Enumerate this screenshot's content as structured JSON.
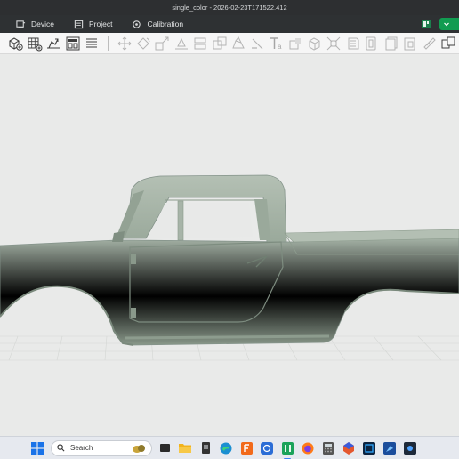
{
  "window": {
    "title": "single_color - 2026-02-23T171522.412"
  },
  "menu": [
    {
      "label": "Device",
      "icon": "device-icon"
    },
    {
      "label": "Project",
      "icon": "project-icon"
    },
    {
      "label": "Calibration",
      "icon": "calibration-icon"
    }
  ],
  "toolbar": {
    "left_tools": [
      "add-object-icon",
      "add-plate-icon",
      "auto-orient-icon",
      "arrange-icon",
      "split-list-icon"
    ],
    "right_tools": [
      "move-icon",
      "rotate-icon",
      "scale-icon",
      "lay-flat-icon",
      "cut-icon",
      "boolean-icon",
      "support-paint-icon",
      "seam-paint-icon",
      "text-icon",
      "measure-icon",
      "assembly-icon",
      "variable-layer-icon",
      "split-objects-icon",
      "split-parts-icon",
      "copy-icon",
      "paste-icon",
      "ruler-icon",
      "object-list-icon"
    ]
  },
  "taskbar": {
    "search_placeholder": "Search",
    "apps": [
      "task-view-icon",
      "file-explorer-icon",
      "terminal-icon",
      "edge-icon",
      "fusion-icon",
      "app-store-icon",
      "slicer-icon",
      "firefox-icon",
      "calculator-icon",
      "prusa-icon",
      "photoshop-icon",
      "paint-icon",
      "app-icon"
    ]
  },
  "colors": {
    "model": "#a4b2a5",
    "accent_green": "#119c51",
    "titlebar": "#2d2f31"
  }
}
